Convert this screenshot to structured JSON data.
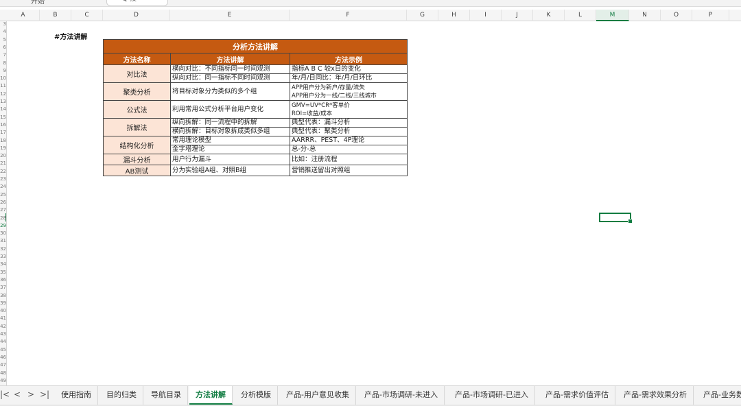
{
  "topbar": {
    "left_text": "开始",
    "search_text": "Q 搜"
  },
  "columns": [
    "A",
    "B",
    "C",
    "D",
    "E",
    "F",
    "G",
    "H",
    "I",
    "J",
    "K",
    "L",
    "M",
    "N",
    "O",
    "P"
  ],
  "active_column": "M",
  "rows": [
    "3",
    "4",
    "5",
    "6",
    "7",
    "8",
    "9",
    "10",
    "11",
    "12",
    "13",
    "14",
    "15",
    "16",
    "17",
    "18",
    "19",
    "20",
    "21",
    "22",
    "23",
    "24",
    "25",
    "26",
    "27",
    "28",
    "29",
    "30",
    "31",
    "32",
    "33",
    "34",
    "35",
    "36",
    "37",
    "38",
    "39",
    "40",
    "41",
    "42",
    "43",
    "44",
    "45",
    "46",
    "47",
    "48",
    "49"
  ],
  "sheet_title": "#方法讲解",
  "table": {
    "banner": "分析方法讲解",
    "headers": [
      "方法名称",
      "方法讲解",
      "方法示例"
    ],
    "groups": [
      {
        "name": "对比法",
        "rows": [
          {
            "explain": "横向对比：不同指标同一时间观测",
            "example": "指标A B C 较x日的变化"
          },
          {
            "explain": "纵向对比：同一指标不同时间观测",
            "example": "年/月/日同比：年/月/日环比"
          }
        ]
      },
      {
        "name": "聚类分析",
        "rows": [
          {
            "explain": "将目标对象分为类似的多个组",
            "examples": [
              "APP用户分为新户/存量/流失",
              "APP用户分为一线/二线/三线城市"
            ]
          }
        ]
      },
      {
        "name": "公式法",
        "rows": [
          {
            "explain": "利用常用公式分析平台用户变化",
            "examples": [
              "GMV=UV*CR*客单价",
              "ROI=收益/成本"
            ]
          }
        ]
      },
      {
        "name": "拆解法",
        "rows": [
          {
            "explain": "纵向拆解：同一流程中的拆解",
            "example": "典型代表：漏斗分析"
          },
          {
            "explain": "横向拆解：目标对象拆成类似多组",
            "example": "典型代表：聚类分析"
          }
        ]
      },
      {
        "name": "结构化分析",
        "rows": [
          {
            "explain": "常用理论模型",
            "example": "AARRR、PEST、4P理论"
          },
          {
            "explain": "金字塔理论",
            "example": "总-分-总"
          }
        ]
      },
      {
        "name": "漏斗分析",
        "rows": [
          {
            "explain": "用户行为漏斗",
            "example": "比如：注册流程"
          }
        ]
      },
      {
        "name": "AB测试",
        "rows": [
          {
            "explain": "分为实验组A组、对照B组",
            "example": "营销推送留出对照组"
          }
        ]
      }
    ]
  },
  "tabs": {
    "nav": [
      "|<",
      "<",
      ">",
      ">|"
    ],
    "items": [
      "使用指南",
      "目的归类",
      "导航目录",
      "方法讲解",
      "分析模版",
      "产品-用户意见收集",
      "产品-市场调研-未进入",
      "产品-市场调研-已进入",
      "产品-需求价值评估",
      "产品-需求效果分析",
      "产品-业务数"
    ],
    "active": "方法讲解"
  },
  "colors": {
    "accent": "#c55a11",
    "name_fill": "#fce4d6",
    "excel_green": "#107c41"
  }
}
